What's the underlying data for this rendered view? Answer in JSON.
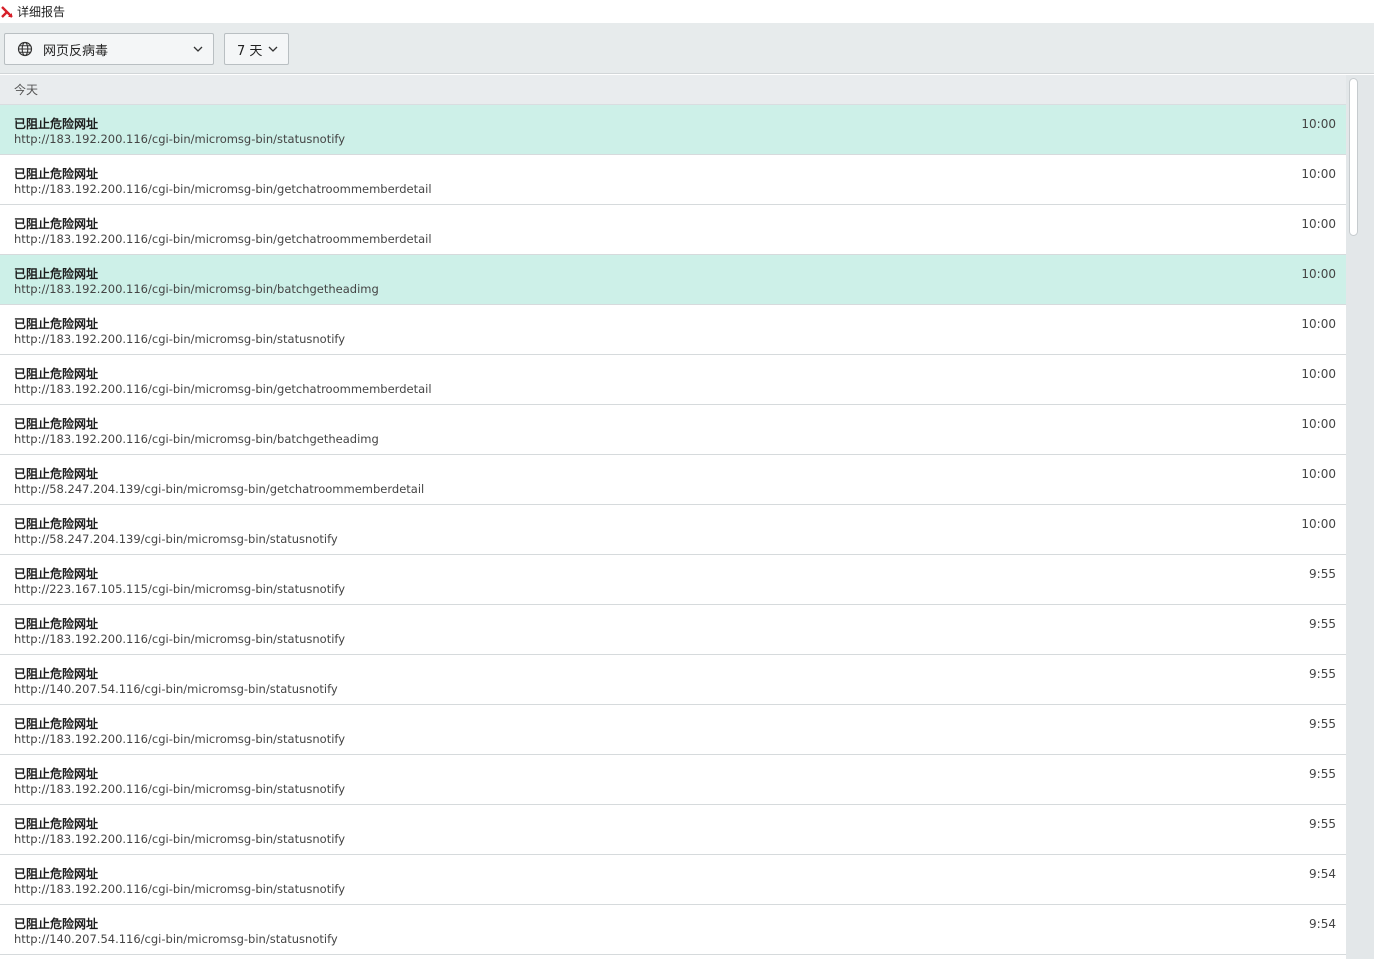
{
  "window": {
    "title": "详细报告"
  },
  "toolbar": {
    "component_select": {
      "value": "网页反病毒",
      "icon": "globe-icon"
    },
    "period_select": {
      "value": "7 天"
    }
  },
  "report": {
    "group_label": "今天",
    "highlight_color": "#cdf0e8",
    "events": [
      {
        "title": "已阻止危险网址",
        "url": "http://183.192.200.116/cgi-bin/micromsg-bin/statusnotify",
        "time": "10:00",
        "highlighted": true
      },
      {
        "title": "已阻止危险网址",
        "url": "http://183.192.200.116/cgi-bin/micromsg-bin/getchatroommemberdetail",
        "time": "10:00",
        "highlighted": false
      },
      {
        "title": "已阻止危险网址",
        "url": "http://183.192.200.116/cgi-bin/micromsg-bin/getchatroommemberdetail",
        "time": "10:00",
        "highlighted": false
      },
      {
        "title": "已阻止危险网址",
        "url": "http://183.192.200.116/cgi-bin/micromsg-bin/batchgetheadimg",
        "time": "10:00",
        "highlighted": true
      },
      {
        "title": "已阻止危险网址",
        "url": "http://183.192.200.116/cgi-bin/micromsg-bin/statusnotify",
        "time": "10:00",
        "highlighted": false
      },
      {
        "title": "已阻止危险网址",
        "url": "http://183.192.200.116/cgi-bin/micromsg-bin/getchatroommemberdetail",
        "time": "10:00",
        "highlighted": false
      },
      {
        "title": "已阻止危险网址",
        "url": "http://183.192.200.116/cgi-bin/micromsg-bin/batchgetheadimg",
        "time": "10:00",
        "highlighted": false
      },
      {
        "title": "已阻止危险网址",
        "url": "http://58.247.204.139/cgi-bin/micromsg-bin/getchatroommemberdetail",
        "time": "10:00",
        "highlighted": false
      },
      {
        "title": "已阻止危险网址",
        "url": "http://58.247.204.139/cgi-bin/micromsg-bin/statusnotify",
        "time": "10:00",
        "highlighted": false
      },
      {
        "title": "已阻止危险网址",
        "url": "http://223.167.105.115/cgi-bin/micromsg-bin/statusnotify",
        "time": "9:55",
        "highlighted": false
      },
      {
        "title": "已阻止危险网址",
        "url": "http://183.192.200.116/cgi-bin/micromsg-bin/statusnotify",
        "time": "9:55",
        "highlighted": false
      },
      {
        "title": "已阻止危险网址",
        "url": "http://140.207.54.116/cgi-bin/micromsg-bin/statusnotify",
        "time": "9:55",
        "highlighted": false
      },
      {
        "title": "已阻止危险网址",
        "url": "http://183.192.200.116/cgi-bin/micromsg-bin/statusnotify",
        "time": "9:55",
        "highlighted": false
      },
      {
        "title": "已阻止危险网址",
        "url": "http://183.192.200.116/cgi-bin/micromsg-bin/statusnotify",
        "time": "9:55",
        "highlighted": false
      },
      {
        "title": "已阻止危险网址",
        "url": "http://183.192.200.116/cgi-bin/micromsg-bin/statusnotify",
        "time": "9:55",
        "highlighted": false
      },
      {
        "title": "已阻止危险网址",
        "url": "http://183.192.200.116/cgi-bin/micromsg-bin/statusnotify",
        "time": "9:54",
        "highlighted": false
      },
      {
        "title": "已阻止危险网址",
        "url": "http://140.207.54.116/cgi-bin/micromsg-bin/statusnotify",
        "time": "9:54",
        "highlighted": false
      }
    ]
  }
}
